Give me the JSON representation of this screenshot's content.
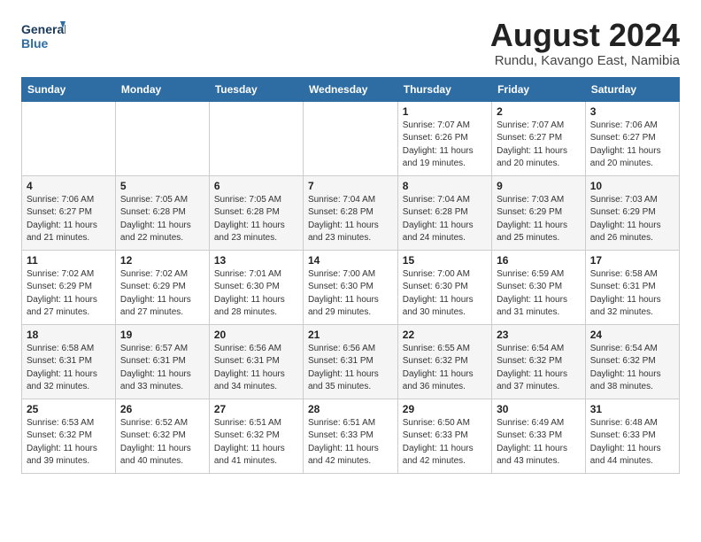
{
  "header": {
    "logo_line1": "General",
    "logo_line2": "Blue",
    "main_title": "August 2024",
    "sub_title": "Rundu, Kavango East, Namibia"
  },
  "weekdays": [
    "Sunday",
    "Monday",
    "Tuesday",
    "Wednesday",
    "Thursday",
    "Friday",
    "Saturday"
  ],
  "weeks": [
    [
      {
        "day": "",
        "info": ""
      },
      {
        "day": "",
        "info": ""
      },
      {
        "day": "",
        "info": ""
      },
      {
        "day": "",
        "info": ""
      },
      {
        "day": "1",
        "info": "Sunrise: 7:07 AM\nSunset: 6:26 PM\nDaylight: 11 hours\nand 19 minutes."
      },
      {
        "day": "2",
        "info": "Sunrise: 7:07 AM\nSunset: 6:27 PM\nDaylight: 11 hours\nand 20 minutes."
      },
      {
        "day": "3",
        "info": "Sunrise: 7:06 AM\nSunset: 6:27 PM\nDaylight: 11 hours\nand 20 minutes."
      }
    ],
    [
      {
        "day": "4",
        "info": "Sunrise: 7:06 AM\nSunset: 6:27 PM\nDaylight: 11 hours\nand 21 minutes."
      },
      {
        "day": "5",
        "info": "Sunrise: 7:05 AM\nSunset: 6:28 PM\nDaylight: 11 hours\nand 22 minutes."
      },
      {
        "day": "6",
        "info": "Sunrise: 7:05 AM\nSunset: 6:28 PM\nDaylight: 11 hours\nand 23 minutes."
      },
      {
        "day": "7",
        "info": "Sunrise: 7:04 AM\nSunset: 6:28 PM\nDaylight: 11 hours\nand 23 minutes."
      },
      {
        "day": "8",
        "info": "Sunrise: 7:04 AM\nSunset: 6:28 PM\nDaylight: 11 hours\nand 24 minutes."
      },
      {
        "day": "9",
        "info": "Sunrise: 7:03 AM\nSunset: 6:29 PM\nDaylight: 11 hours\nand 25 minutes."
      },
      {
        "day": "10",
        "info": "Sunrise: 7:03 AM\nSunset: 6:29 PM\nDaylight: 11 hours\nand 26 minutes."
      }
    ],
    [
      {
        "day": "11",
        "info": "Sunrise: 7:02 AM\nSunset: 6:29 PM\nDaylight: 11 hours\nand 27 minutes."
      },
      {
        "day": "12",
        "info": "Sunrise: 7:02 AM\nSunset: 6:29 PM\nDaylight: 11 hours\nand 27 minutes."
      },
      {
        "day": "13",
        "info": "Sunrise: 7:01 AM\nSunset: 6:30 PM\nDaylight: 11 hours\nand 28 minutes."
      },
      {
        "day": "14",
        "info": "Sunrise: 7:00 AM\nSunset: 6:30 PM\nDaylight: 11 hours\nand 29 minutes."
      },
      {
        "day": "15",
        "info": "Sunrise: 7:00 AM\nSunset: 6:30 PM\nDaylight: 11 hours\nand 30 minutes."
      },
      {
        "day": "16",
        "info": "Sunrise: 6:59 AM\nSunset: 6:30 PM\nDaylight: 11 hours\nand 31 minutes."
      },
      {
        "day": "17",
        "info": "Sunrise: 6:58 AM\nSunset: 6:31 PM\nDaylight: 11 hours\nand 32 minutes."
      }
    ],
    [
      {
        "day": "18",
        "info": "Sunrise: 6:58 AM\nSunset: 6:31 PM\nDaylight: 11 hours\nand 32 minutes."
      },
      {
        "day": "19",
        "info": "Sunrise: 6:57 AM\nSunset: 6:31 PM\nDaylight: 11 hours\nand 33 minutes."
      },
      {
        "day": "20",
        "info": "Sunrise: 6:56 AM\nSunset: 6:31 PM\nDaylight: 11 hours\nand 34 minutes."
      },
      {
        "day": "21",
        "info": "Sunrise: 6:56 AM\nSunset: 6:31 PM\nDaylight: 11 hours\nand 35 minutes."
      },
      {
        "day": "22",
        "info": "Sunrise: 6:55 AM\nSunset: 6:32 PM\nDaylight: 11 hours\nand 36 minutes."
      },
      {
        "day": "23",
        "info": "Sunrise: 6:54 AM\nSunset: 6:32 PM\nDaylight: 11 hours\nand 37 minutes."
      },
      {
        "day": "24",
        "info": "Sunrise: 6:54 AM\nSunset: 6:32 PM\nDaylight: 11 hours\nand 38 minutes."
      }
    ],
    [
      {
        "day": "25",
        "info": "Sunrise: 6:53 AM\nSunset: 6:32 PM\nDaylight: 11 hours\nand 39 minutes."
      },
      {
        "day": "26",
        "info": "Sunrise: 6:52 AM\nSunset: 6:32 PM\nDaylight: 11 hours\nand 40 minutes."
      },
      {
        "day": "27",
        "info": "Sunrise: 6:51 AM\nSunset: 6:32 PM\nDaylight: 11 hours\nand 41 minutes."
      },
      {
        "day": "28",
        "info": "Sunrise: 6:51 AM\nSunset: 6:33 PM\nDaylight: 11 hours\nand 42 minutes."
      },
      {
        "day": "29",
        "info": "Sunrise: 6:50 AM\nSunset: 6:33 PM\nDaylight: 11 hours\nand 42 minutes."
      },
      {
        "day": "30",
        "info": "Sunrise: 6:49 AM\nSunset: 6:33 PM\nDaylight: 11 hours\nand 43 minutes."
      },
      {
        "day": "31",
        "info": "Sunrise: 6:48 AM\nSunset: 6:33 PM\nDaylight: 11 hours\nand 44 minutes."
      }
    ]
  ]
}
